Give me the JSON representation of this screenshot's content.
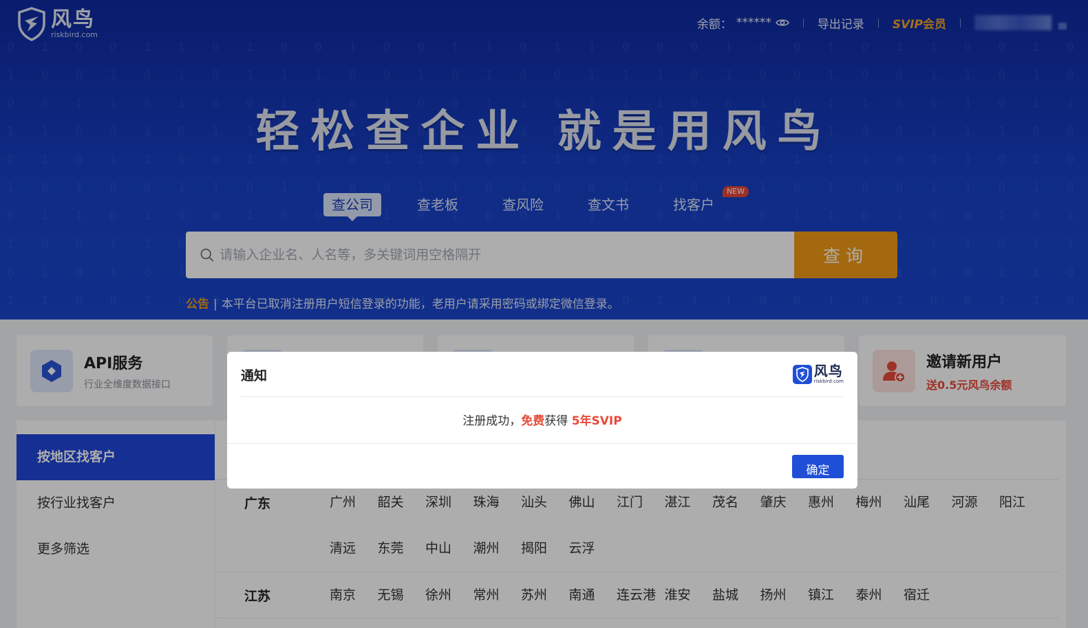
{
  "brand": {
    "name": "风鸟",
    "domain": "riskbird.com"
  },
  "topbar": {
    "balance_label": "余额：",
    "balance_value": "******",
    "export_label": "导出记录",
    "svip_prefix": "SVIP",
    "svip_label": "会员"
  },
  "hero": {
    "slogan": "轻松查企业 就是用风鸟",
    "tabs": [
      {
        "label": "查公司",
        "active": true
      },
      {
        "label": "查老板"
      },
      {
        "label": "查风险"
      },
      {
        "label": "查文书"
      },
      {
        "label": "找客户",
        "badge": "NEW"
      }
    ],
    "search": {
      "placeholder": "请输入企业名、人名等，多关键词用空格隔开",
      "button": "查询"
    },
    "notice": {
      "label": "公告",
      "text": "本平台已取消注册用户短信登录的功能，老用户请采用密码或绑定微信登录。"
    }
  },
  "cards": [
    {
      "title": "API服务",
      "subtitle": "行业全维度数据接口",
      "icon": "link-icon"
    },
    {
      "title": "邀请新用户",
      "subtitle": "送0.5元风鸟余额",
      "icon": "add-user-icon"
    }
  ],
  "sidemenu": {
    "items": [
      "按地区找客户",
      "按行业找客户",
      "更多筛选"
    ]
  },
  "regions": [
    {
      "province": "广东",
      "cities": [
        "广州",
        "韶关",
        "深圳",
        "珠海",
        "汕头",
        "佛山",
        "江门",
        "湛江",
        "茂名",
        "肇庆",
        "惠州",
        "梅州",
        "汕尾",
        "河源",
        "阳江",
        "清远",
        "东莞",
        "中山",
        "潮州",
        "揭阳",
        "云浮"
      ]
    },
    {
      "province": "江苏",
      "cities": [
        "南京",
        "无锡",
        "徐州",
        "常州",
        "苏州",
        "南通",
        "连云港",
        "淮安",
        "盐城",
        "扬州",
        "镇江",
        "泰州",
        "宿迁"
      ]
    }
  ],
  "modal": {
    "title": "通知",
    "logo_cn": "风鸟",
    "logo_en": "riskbird.com",
    "body_prefix": "注册成功，",
    "body_free": "免费",
    "body_mid": "获得 ",
    "body_svip": "5年SVIP",
    "ok_button": "确定"
  },
  "colors": {
    "primary": "#1f4fd6",
    "accent": "#f29a17",
    "highlight": "#e84a3a",
    "hero": "#1740c4"
  }
}
